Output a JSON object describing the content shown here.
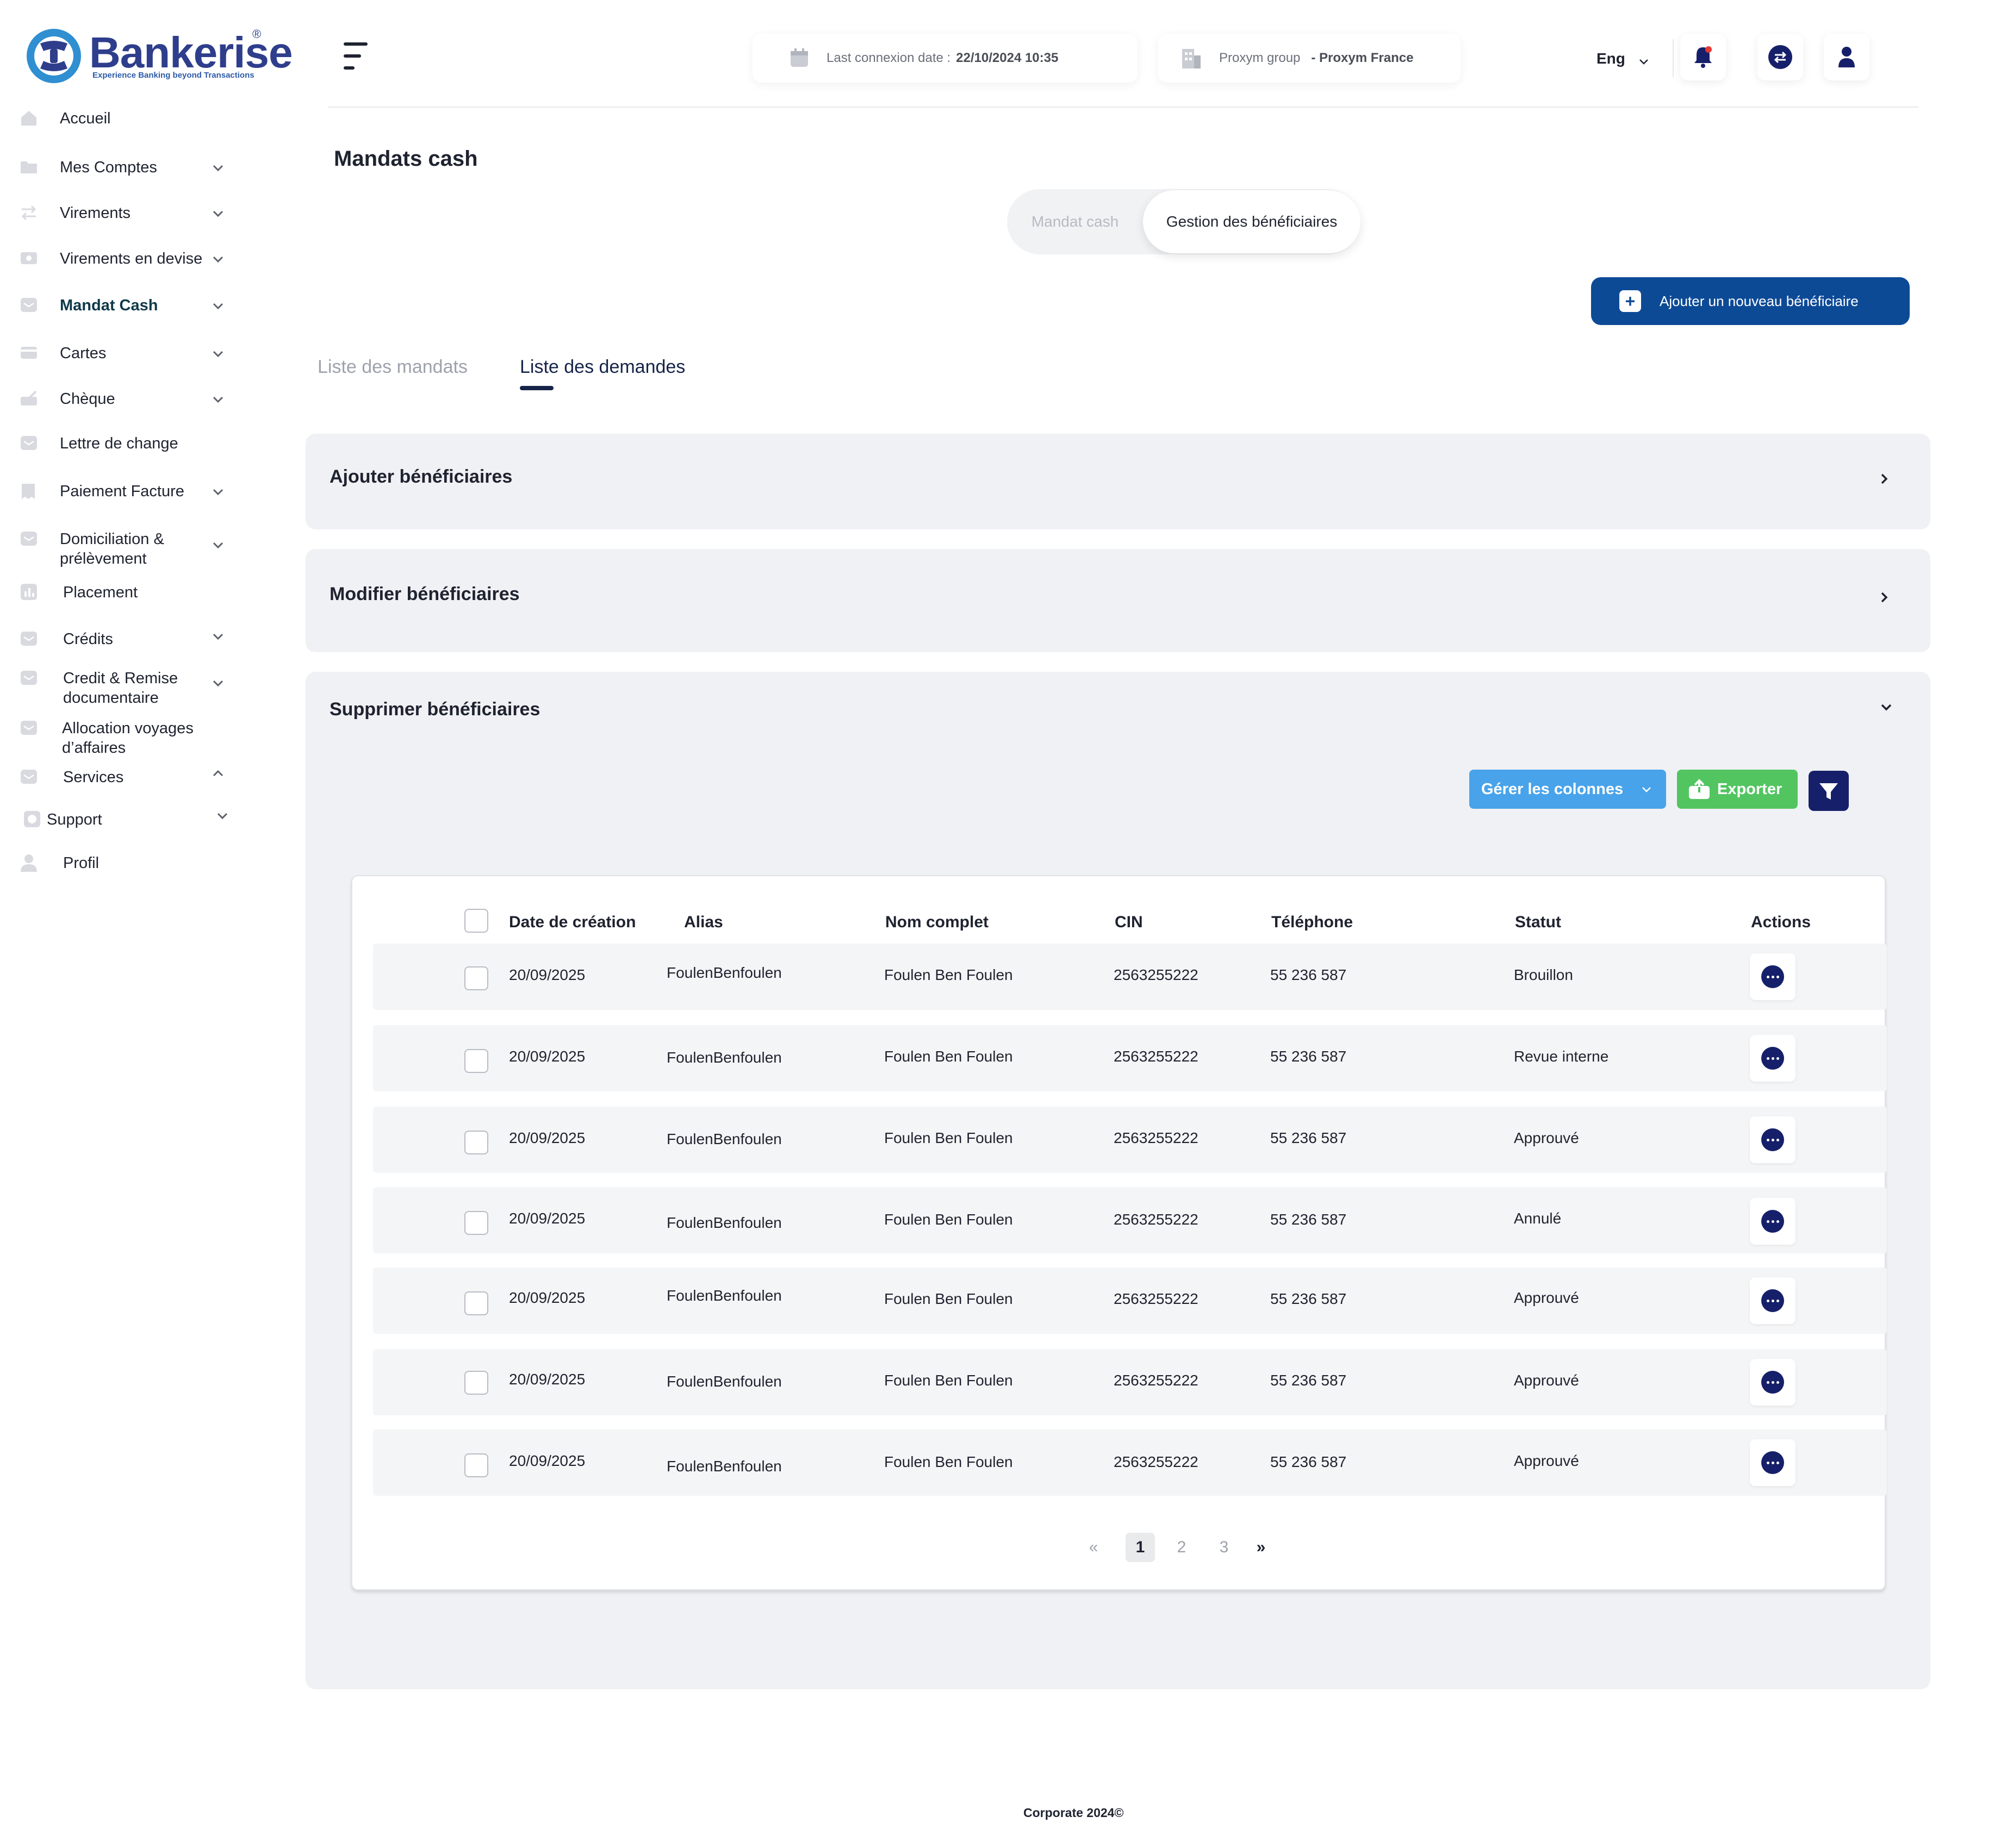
{
  "brand": {
    "name": "Bankerise",
    "registered": "®",
    "tagline": "Experience Banking beyond Transactions"
  },
  "sidebar": {
    "items": [
      {
        "label": "Accueil",
        "icon": "home-icon"
      },
      {
        "label": "Mes Comptes",
        "icon": "folder-icon"
      },
      {
        "label": "Virements",
        "icon": "transfer-icon"
      },
      {
        "label": "Virements en devise",
        "icon": "currency-icon"
      },
      {
        "label": "Mandat Cash",
        "icon": "mail-icon"
      },
      {
        "label": "Cartes",
        "icon": "card-icon"
      },
      {
        "label": "Chèque",
        "icon": "cheque-icon"
      },
      {
        "label": "Lettre de change",
        "icon": "mail-icon"
      },
      {
        "label": "Paiement Facture",
        "icon": "invoice-icon"
      },
      {
        "label": "Domiciliation & prélèvement",
        "icon": "mail-icon"
      },
      {
        "label": "Placement",
        "icon": "chart-icon"
      },
      {
        "label": "Crédits",
        "icon": "mail-icon"
      },
      {
        "label": "Credit & Remise documentaire",
        "icon": "mail-icon"
      },
      {
        "label": "Allocation  voyages d’affaires",
        "icon": "mail-icon"
      },
      {
        "label": "Services",
        "icon": "mail-icon"
      },
      {
        "label": "Support",
        "icon": "support-icon"
      },
      {
        "label": "Profil",
        "icon": "user-icon"
      }
    ]
  },
  "topbar": {
    "last_connexion_label": "Last connexion date :",
    "last_connexion_value": "22/10/2024 10:35",
    "group_label": "Proxym group",
    "group_value": "- Proxym France",
    "language": "Eng"
  },
  "page": {
    "title": "Mandats cash",
    "segment_options": [
      "Mandat cash",
      "Gestion des bénéficiaires"
    ],
    "add_button": "Ajouter un nouveau bénéficiaire",
    "tabs": [
      "Liste des mandats",
      "Liste des demandes"
    ]
  },
  "accordions": {
    "add": "Ajouter  bénéficiaires",
    "edit": "Modifier bénéficiaires",
    "delete": "Supprimer bénéficiaires"
  },
  "toolbar": {
    "manage_columns": "Gérer les colonnes",
    "export": "Exporter"
  },
  "table": {
    "headers": [
      "Date de création",
      "Alias",
      "Nom complet",
      "CIN",
      "Téléphone",
      "Statut",
      "Actions"
    ],
    "rows": [
      {
        "date": "20/09/2025",
        "alias": "FoulenBenfoulen",
        "name": "Foulen Ben Foulen",
        "cin": "2563255222",
        "phone": "55 236 587",
        "status": "Brouillon"
      },
      {
        "date": "20/09/2025",
        "alias": "FoulenBenfoulen",
        "name": "Foulen Ben Foulen",
        "cin": "2563255222",
        "phone": "55 236 587",
        "status": "Revue interne"
      },
      {
        "date": "20/09/2025",
        "alias": "FoulenBenfoulen",
        "name": "Foulen Ben Foulen",
        "cin": "2563255222",
        "phone": "55 236 587",
        "status": "Approuvé"
      },
      {
        "date": "20/09/2025",
        "alias": "FoulenBenfoulen",
        "name": "Foulen Ben Foulen",
        "cin": "2563255222",
        "phone": "55 236 587",
        "status": "Annulé"
      },
      {
        "date": "20/09/2025",
        "alias": "FoulenBenfoulen",
        "name": "Foulen Ben Foulen",
        "cin": "2563255222",
        "phone": "55 236 587",
        "status": "Approuvé"
      },
      {
        "date": "20/09/2025",
        "alias": "FoulenBenfoulen",
        "name": "Foulen Ben Foulen",
        "cin": "2563255222",
        "phone": "55 236 587",
        "status": "Approuvé"
      },
      {
        "date": "20/09/2025",
        "alias": "FoulenBenfoulen",
        "name": "Foulen Ben Foulen",
        "cin": "2563255222",
        "phone": "55 236 587",
        "status": "Approuvé"
      }
    ]
  },
  "pagination": {
    "first": "«",
    "pages": [
      "1",
      "2",
      "3"
    ],
    "current": "1",
    "last": "»"
  },
  "footer": "Corporate 2024©",
  "colors": {
    "primary": "#0d4a96",
    "navy": "#16206a",
    "brand": "#2e3e8c",
    "columns_button": "#48a3ea",
    "export_button": "#52c561",
    "notification_dot": "#e53935"
  }
}
